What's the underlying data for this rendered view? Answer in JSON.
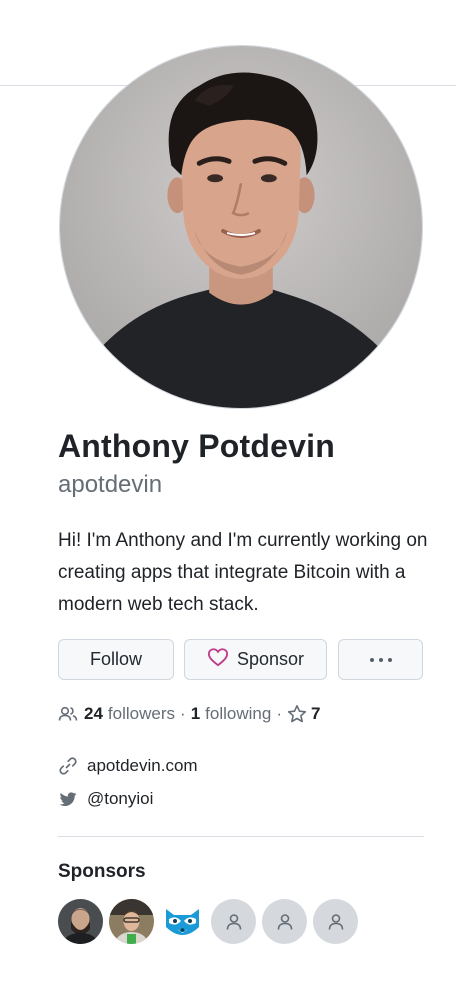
{
  "profile": {
    "name": "Anthony Potdevin",
    "login": "apotdevin",
    "bio": "Hi! I'm Anthony and I'm currently working on creating apps that integrate Bitcoin with a modern web tech stack."
  },
  "actions": {
    "follow_label": "Follow",
    "sponsor_label": "Sponsor"
  },
  "stats": {
    "followers_count": "24",
    "followers_label": "followers",
    "separator": "·",
    "following_count": "1",
    "following_label": "following",
    "stars_count": "7"
  },
  "links": {
    "website": "apotdevin.com",
    "twitter": "@tonyioi"
  },
  "sponsors": {
    "title": "Sponsors"
  },
  "colors": {
    "sponsor_heart": "#bf3989",
    "muted_text": "#656d76",
    "border": "#d0d7de"
  }
}
